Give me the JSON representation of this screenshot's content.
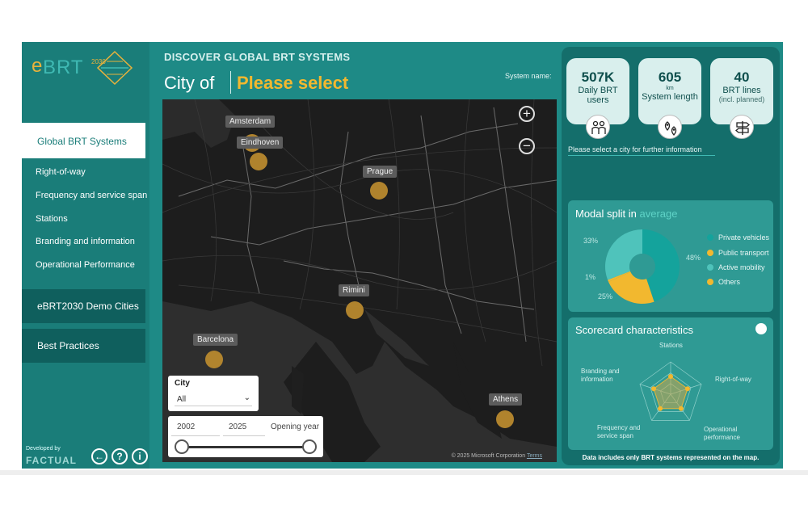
{
  "sidebar": {
    "logo": {
      "e": "e",
      "brt": "BRT",
      "year": "2030"
    },
    "active_item": "Global BRT Systems",
    "items": [
      "Right-of-way",
      "Frequency and service span",
      "Stations",
      "Branding and information",
      "Operational Performance"
    ],
    "blocks": [
      "eBRT2030 Demo Cities",
      "Best Practices"
    ],
    "developed_by": "Developed by",
    "developer": "FACTUAL",
    "footer_icons": [
      "back-arrow-icon",
      "help-icon",
      "info-icon"
    ]
  },
  "header": {
    "title": "DISCOVER GLOBAL BRT SYSTEMS",
    "city_prefix": "City of",
    "city_value": "Please select",
    "system_name_label": "System name:"
  },
  "map": {
    "cities": [
      {
        "name": "Amsterdam"
      },
      {
        "name": "Eindhoven"
      },
      {
        "name": "Prague"
      },
      {
        "name": "Rimini"
      },
      {
        "name": "Barcelona"
      },
      {
        "name": "Athens"
      }
    ],
    "zoom_in": "+",
    "zoom_out": "−",
    "copyright": "© 2025 Microsoft Corporation",
    "terms": "Terms",
    "marker_color": "#b8892e"
  },
  "slicers": {
    "city_label": "City",
    "city_value": "All",
    "year_start": "2002",
    "year_end": "2025",
    "year_label": "Opening year"
  },
  "kpis": [
    {
      "value": "507K",
      "unit": "",
      "label": "Daily BRT users",
      "sub": "",
      "icon": "people-icon"
    },
    {
      "value": "605",
      "unit": "km",
      "label": "System length",
      "sub": "",
      "icon": "map-pins-icon"
    },
    {
      "value": "40",
      "unit": "",
      "label": "BRT lines",
      "sub": "(incl. planned)",
      "icon": "signpost-icon"
    }
  ],
  "kpi_message": "Please select a city for further information",
  "modal_split": {
    "title": "Modal split in",
    "title_accent": "average",
    "labels": [
      "48%",
      "25%",
      "1%",
      "33%"
    ],
    "legend": [
      {
        "name": "Private vehicles",
        "color": "#2aa9a3"
      },
      {
        "name": "Public transport",
        "color": "#f2b82f"
      },
      {
        "name": "Active mobility",
        "color": "#5fd3c7"
      },
      {
        "name": "Others",
        "color": "#f2b82f"
      }
    ]
  },
  "chart_data": {
    "type": "pie",
    "categories": [
      "Private vehicles",
      "Public transport",
      "Others",
      "Active mobility"
    ],
    "values": [
      48,
      25,
      1,
      33
    ],
    "colors": [
      "#14a39c",
      "#f2b82f",
      "#f2b82f",
      "#4fc3bb"
    ]
  },
  "scorecard": {
    "title": "Scorecard characteristics",
    "axes": [
      "Stations",
      "Right-of-way",
      "Operational performance",
      "Frequency and service span",
      "Branding and information"
    ],
    "label_lines": {
      "stations": [
        "Stations"
      ],
      "row": [
        "Right-of-way"
      ],
      "ops": [
        "Operational",
        "performance"
      ],
      "freq": [
        "Frequency and",
        "service span"
      ],
      "brand": [
        "Branding and",
        "information"
      ]
    },
    "values": [
      0.55,
      0.55,
      0.55,
      0.55,
      0.55
    ],
    "disclaimer": "Data includes only BRT systems represented on the map."
  }
}
